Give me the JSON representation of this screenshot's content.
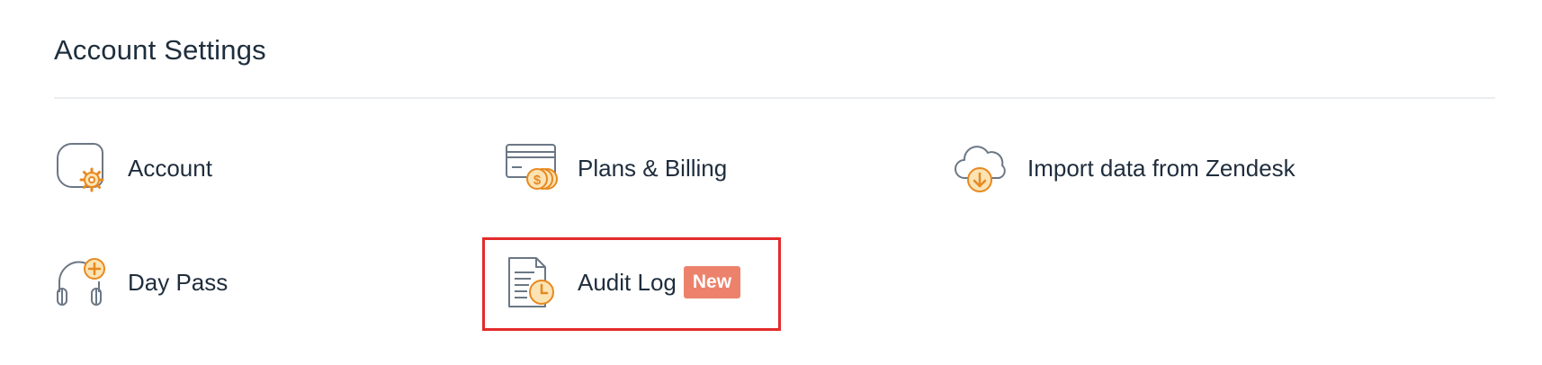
{
  "page": {
    "title": "Account Settings"
  },
  "colors": {
    "icon_stroke": "#6b7785",
    "icon_accent": "#f5a623",
    "badge_bg": "#ec826c",
    "highlight": "#e32b2b"
  },
  "settings": {
    "items": [
      {
        "label": "Account",
        "icon": "account-gear-icon"
      },
      {
        "label": "Plans & Billing",
        "icon": "billing-card-coins-icon"
      },
      {
        "label": "Import data from Zendesk",
        "icon": "cloud-download-icon"
      },
      {
        "label": "Day Pass",
        "icon": "headset-plus-icon"
      },
      {
        "label": "Audit Log",
        "icon": "document-clock-icon",
        "badge": "New"
      }
    ]
  }
}
